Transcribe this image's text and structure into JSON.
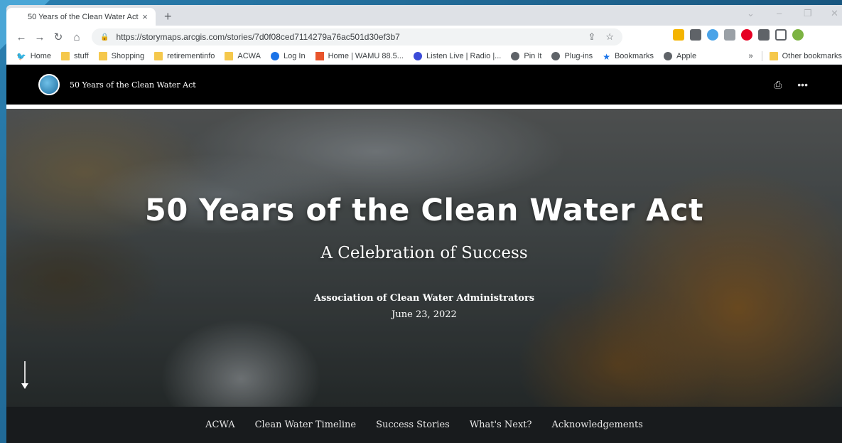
{
  "browser": {
    "tab_title": "50 Years of the Clean Water Act",
    "tab_close": "×",
    "new_tab": "+",
    "url": "https://storymaps.arcgis.com/stories/7d0f08ced7114279a76ac501d30ef3b7",
    "nav": {
      "back": "←",
      "forward": "→",
      "reload": "↻",
      "home": "⌂"
    },
    "window_controls": {
      "minimize": "–",
      "restore": "❐",
      "close": "✕",
      "dropdown": "⌄"
    }
  },
  "bookmarks": {
    "items": [
      {
        "label": "Home",
        "icon": "twitter-icon",
        "color": "#1da1f2"
      },
      {
        "label": "stuff",
        "icon": "folder-icon"
      },
      {
        "label": "Shopping",
        "icon": "folder-icon"
      },
      {
        "label": "retirementinfo",
        "icon": "folder-icon"
      },
      {
        "label": "ACWA",
        "icon": "folder-icon"
      },
      {
        "label": "Log In",
        "icon": "blue-circle-icon",
        "color": "#1a73e8"
      },
      {
        "label": "Home | WAMU 88.5...",
        "icon": "wamu-icon",
        "color": "#e8542b"
      },
      {
        "label": "Listen Live | Radio |...",
        "icon": "radio-icon",
        "color": "#3b4bd8"
      },
      {
        "label": "Pin It",
        "icon": "globe-icon"
      },
      {
        "label": "Plug-ins",
        "icon": "globe-icon"
      },
      {
        "label": "Bookmarks",
        "icon": "star-icon",
        "color": "#1a73e8"
      },
      {
        "label": "Apple",
        "icon": "globe-icon"
      }
    ],
    "overflow": "»",
    "other": "Other bookmarks"
  },
  "story": {
    "header_title": "50 Years of the Clean Water Act",
    "share_icon": "⎙",
    "more_icon": "•••"
  },
  "hero": {
    "title": "50 Years of the Clean Water Act",
    "subtitle": "A Celebration of Success",
    "org": "Association of Clean Water Administrators",
    "date": "June 23, 2022"
  },
  "nav": {
    "items": [
      "ACWA",
      "Clean Water Timeline",
      "Success Stories",
      "What's Next?",
      "Acknowledgements"
    ]
  }
}
